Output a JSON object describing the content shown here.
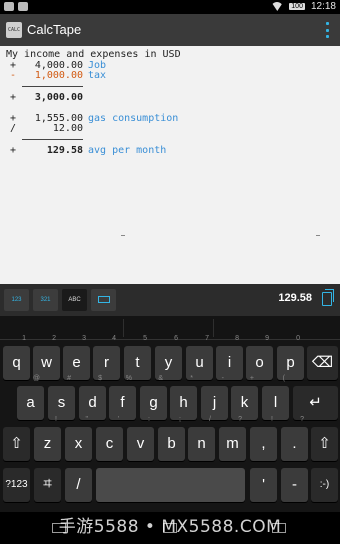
{
  "status_bar": {
    "battery": "100",
    "time": "12:18"
  },
  "app": {
    "title": "CalcTape",
    "icon_text": "CALC"
  },
  "tape": {
    "heading": "My income and expenses in USD",
    "rows": [
      {
        "op": "+",
        "value": "4,000.00",
        "note": "Job"
      },
      {
        "op": "-",
        "value": "1,000.00",
        "note": "tax"
      },
      {
        "op": "+",
        "value": "3,000.00",
        "note": ""
      },
      {
        "op": "+",
        "value": "1,555.00",
        "note": "gas consumption"
      },
      {
        "op": "/",
        "value": "12.00",
        "note": ""
      },
      {
        "op": "+",
        "value": "129.58",
        "note": "avg per month"
      }
    ]
  },
  "modes": [
    {
      "label": "123"
    },
    {
      "label": "321"
    },
    {
      "label": "ABC"
    },
    {
      "label": "keyboard-icon"
    }
  ],
  "result": "129.58",
  "keyboard": {
    "row1": [
      {
        "k": "q",
        "h": "1"
      },
      {
        "k": "w",
        "h": "2"
      },
      {
        "k": "e",
        "h": "3"
      },
      {
        "k": "r",
        "h": "4"
      },
      {
        "k": "t",
        "h": "5"
      },
      {
        "k": "y",
        "h": "6"
      },
      {
        "k": "u",
        "h": "7"
      },
      {
        "k": "i",
        "h": "8"
      },
      {
        "k": "o",
        "h": "9"
      },
      {
        "k": "p",
        "h": "0"
      }
    ],
    "row2": [
      {
        "k": "a",
        "h": "@"
      },
      {
        "k": "s",
        "h": "#"
      },
      {
        "k": "d",
        "h": "$"
      },
      {
        "k": "f",
        "h": "%"
      },
      {
        "k": "g",
        "h": "&"
      },
      {
        "k": "h",
        "h": "*"
      },
      {
        "k": "j",
        "h": "-"
      },
      {
        "k": "k",
        "h": "+"
      },
      {
        "k": "l",
        "h": "("
      }
    ],
    "row3": [
      {
        "k": "z",
        "h": "!"
      },
      {
        "k": "x",
        "h": "\""
      },
      {
        "k": "c",
        "h": "'"
      },
      {
        "k": "v",
        "h": ":"
      },
      {
        "k": "b",
        "h": ";"
      },
      {
        "k": "n",
        "h": "/"
      },
      {
        "k": "m",
        "h": "?"
      },
      {
        "k": ",",
        "h": "!"
      },
      {
        "k": ".",
        "h": "?"
      }
    ],
    "row4": {
      "sym": "?123",
      "lang": "ヰ",
      "slash": "/",
      "quote": "'",
      "dash": "-",
      "smiley": ":-)"
    }
  },
  "watermark": "手游5588 • MX5588.COM"
}
